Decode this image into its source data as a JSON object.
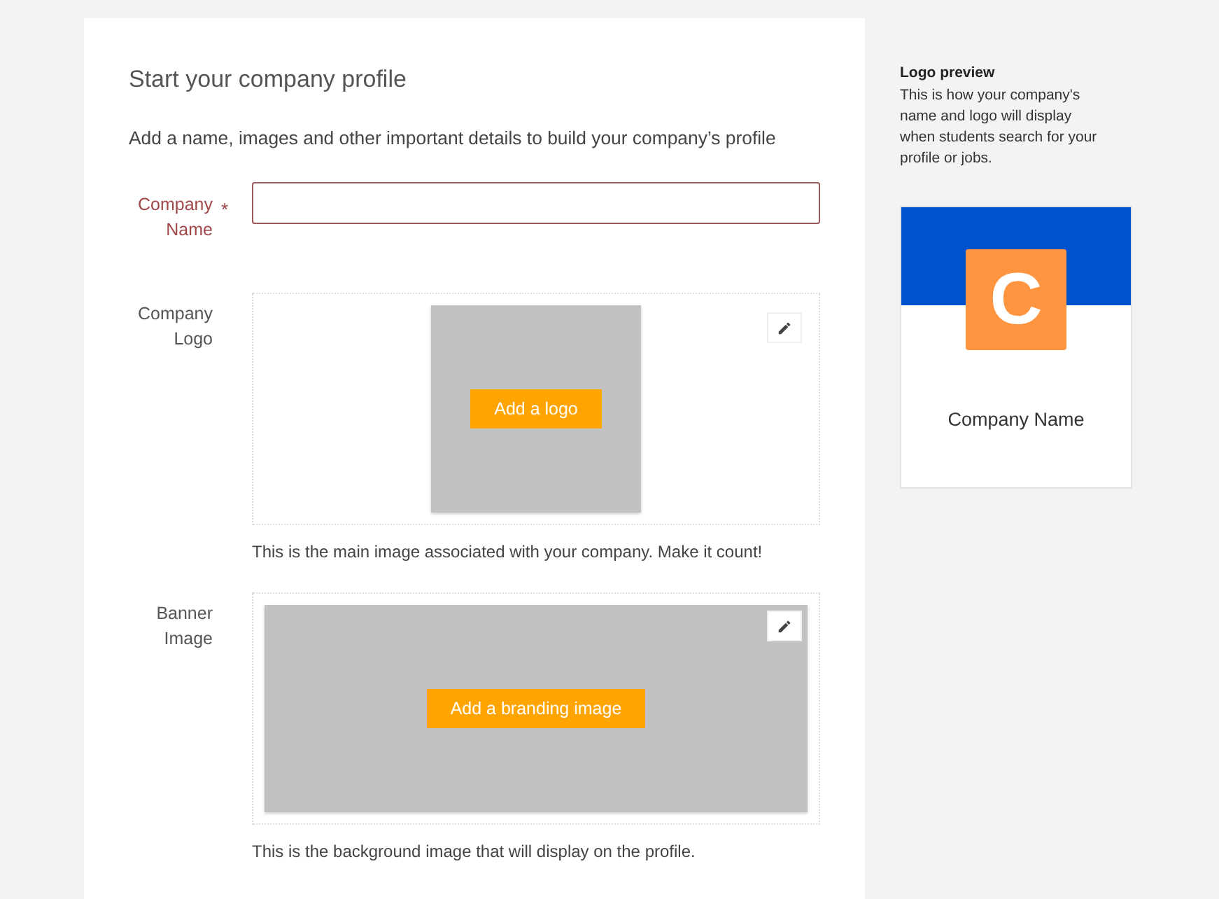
{
  "title": "Start your company profile",
  "subtitle": "Add a name, images and other important details to build your company’s profile",
  "fields": [
    {
      "kind": "text",
      "label": "Company Name",
      "required": true,
      "required_mark": "*"
    },
    {
      "kind": "logo",
      "label": "Company Logo",
      "required": false,
      "button": "Add a logo",
      "help": "This is the main image associated with your company. Make it count!"
    },
    {
      "kind": "banner",
      "label": "Banner Image",
      "required": false,
      "button": "Add a branding image",
      "help": "This is the background image that will display on the profile."
    }
  ],
  "preview": {
    "title": "Logo preview",
    "description": "This is how your company's name and logo will display when students search for your profile or jobs.",
    "initial": "C",
    "company_name": "Company Name"
  }
}
